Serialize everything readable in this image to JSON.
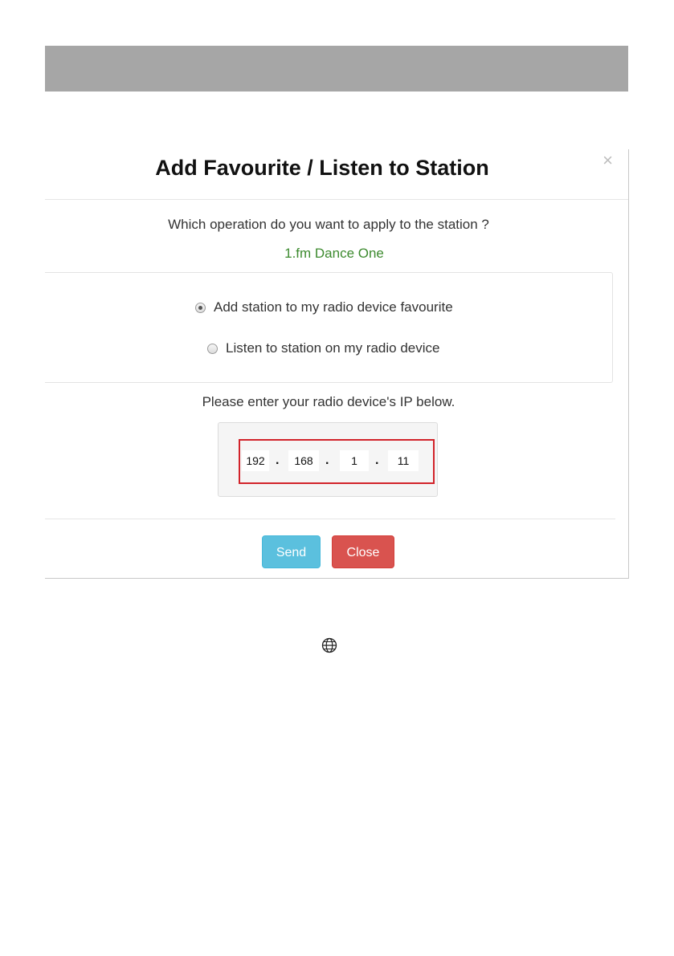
{
  "dialog": {
    "title": "Add Favourite / Listen to Station",
    "close_glyph": "×",
    "question": "Which operation do you want to apply to the station ?",
    "station_name": "1.fm Dance One",
    "options": [
      {
        "label": "Add station to my radio device favourite",
        "checked": true
      },
      {
        "label": "Listen to station on my radio device",
        "checked": false
      }
    ],
    "ip_prompt": "Please enter your radio device's IP below.",
    "ip_octets": [
      "192",
      "168",
      "1",
      "11"
    ],
    "ip_separator": ".",
    "buttons": {
      "send": "Send",
      "close": "Close"
    }
  },
  "colors": {
    "station_text": "#3c8a2e",
    "highlight_box": "#d2232a",
    "send_button": "#5bc0de",
    "close_button": "#d9534f",
    "header_bar": "#a6a6a6"
  },
  "icons": {
    "footer": "globe-icon"
  }
}
